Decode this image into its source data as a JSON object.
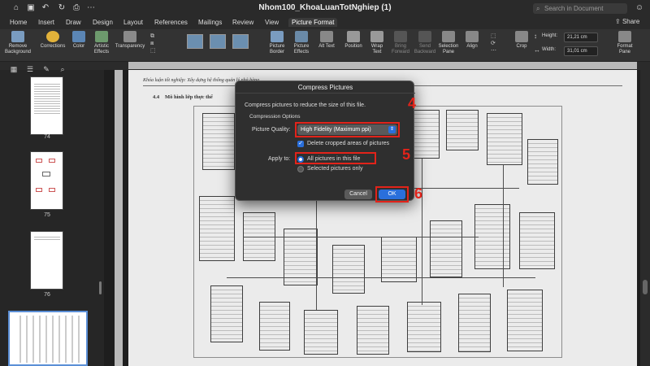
{
  "window": {
    "title": "Nhom100_KhoaLuanTotNghiep (1)"
  },
  "search": {
    "placeholder": "Search in Document"
  },
  "tabs": [
    {
      "label": "Home"
    },
    {
      "label": "Insert"
    },
    {
      "label": "Draw"
    },
    {
      "label": "Design"
    },
    {
      "label": "Layout"
    },
    {
      "label": "References"
    },
    {
      "label": "Mailings"
    },
    {
      "label": "Review"
    },
    {
      "label": "View"
    },
    {
      "label": "Picture Format"
    }
  ],
  "share_label": "Share",
  "ribbon": {
    "remove_background": "Remove Background",
    "corrections": "Corrections",
    "color": "Color",
    "artistic_effects": "Artistic Effects",
    "transparency": "Transparency",
    "picture_border": "Picture Border",
    "picture_effects": "Picture Effects",
    "alt_text": "Alt Text",
    "position": "Position",
    "wrap_text": "Wrap Text",
    "bring_forward": "Bring Forward",
    "send_backward": "Send Backward",
    "selection_pane": "Selection Pane",
    "align": "Align",
    "crop": "Crop",
    "height_label": "Height:",
    "height_value": "21,21 cm",
    "width_label": "Width:",
    "width_value": "31,01 cm",
    "format_pane": "Format Pane"
  },
  "pages": [
    {
      "num": "74"
    },
    {
      "num": "75"
    },
    {
      "num": "76"
    }
  ],
  "document": {
    "header_text": "Khóa luận tốt nghiệp: Xây dựng hệ thống quản lý nhà hàng",
    "section_num": "4.4",
    "section_title": "Mô hình lớp thực thể"
  },
  "dialog": {
    "title": "Compress Pictures",
    "description": "Compress pictures to reduce the size of this file.",
    "options_header": "Compression Options",
    "quality_label": "Picture Quality:",
    "quality_value": "High Fidelity (Maximum ppi)",
    "delete_cropped": "Delete cropped areas of pictures",
    "apply_to_label": "Apply to:",
    "apply_all": "All pictures in this file",
    "apply_selected": "Selected pictures only",
    "cancel_label": "Cancel",
    "ok_label": "OK"
  },
  "annotations": {
    "step4": "4",
    "step5": "5",
    "step6": "6"
  },
  "colors": {
    "accent": "#2a6fdb",
    "annotation_red": "#e2231a"
  }
}
